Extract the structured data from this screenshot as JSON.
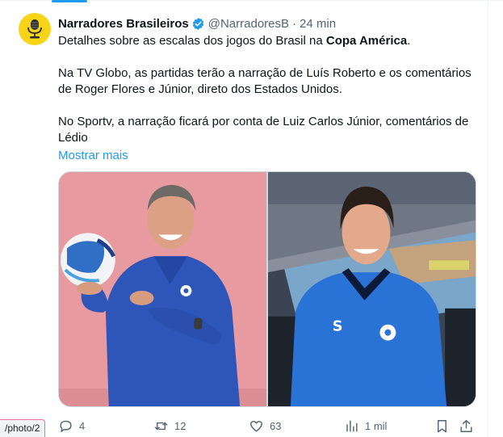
{
  "tweet": {
    "author_name": "Narradores Brasileiros",
    "author_handle": "@NarradoresB",
    "separator": "·",
    "timestamp": "24 min",
    "text_p1_before": "Detalhes sobre as escalas dos jogos do Brasil na ",
    "text_p1_bold": "Copa América",
    "text_p1_after": ".",
    "text_p2": "Na TV Globo, as partidas terão a narração de Luís Roberto e os comentários de Roger Flores e Júnior, direto dos Estados Unidos.",
    "text_p3": "No Sportv, a narração ficará por conta de Luiz Carlos Júnior, comentários de Lédio",
    "show_more": "Mostrar mais"
  },
  "actions": {
    "replies": "4",
    "reposts": "12",
    "likes": "63",
    "views": "1 mil"
  },
  "status_bar": {
    "url_fragment": "/photo/2"
  },
  "colors": {
    "accent": "#1d9bf0",
    "secondary_text": "#536471",
    "avatar_bg": "#f7d417"
  },
  "icons": [
    "microphone-icon",
    "verified-badge-icon",
    "reply-icon",
    "repost-icon",
    "like-icon",
    "views-icon",
    "bookmark-icon",
    "share-icon"
  ]
}
